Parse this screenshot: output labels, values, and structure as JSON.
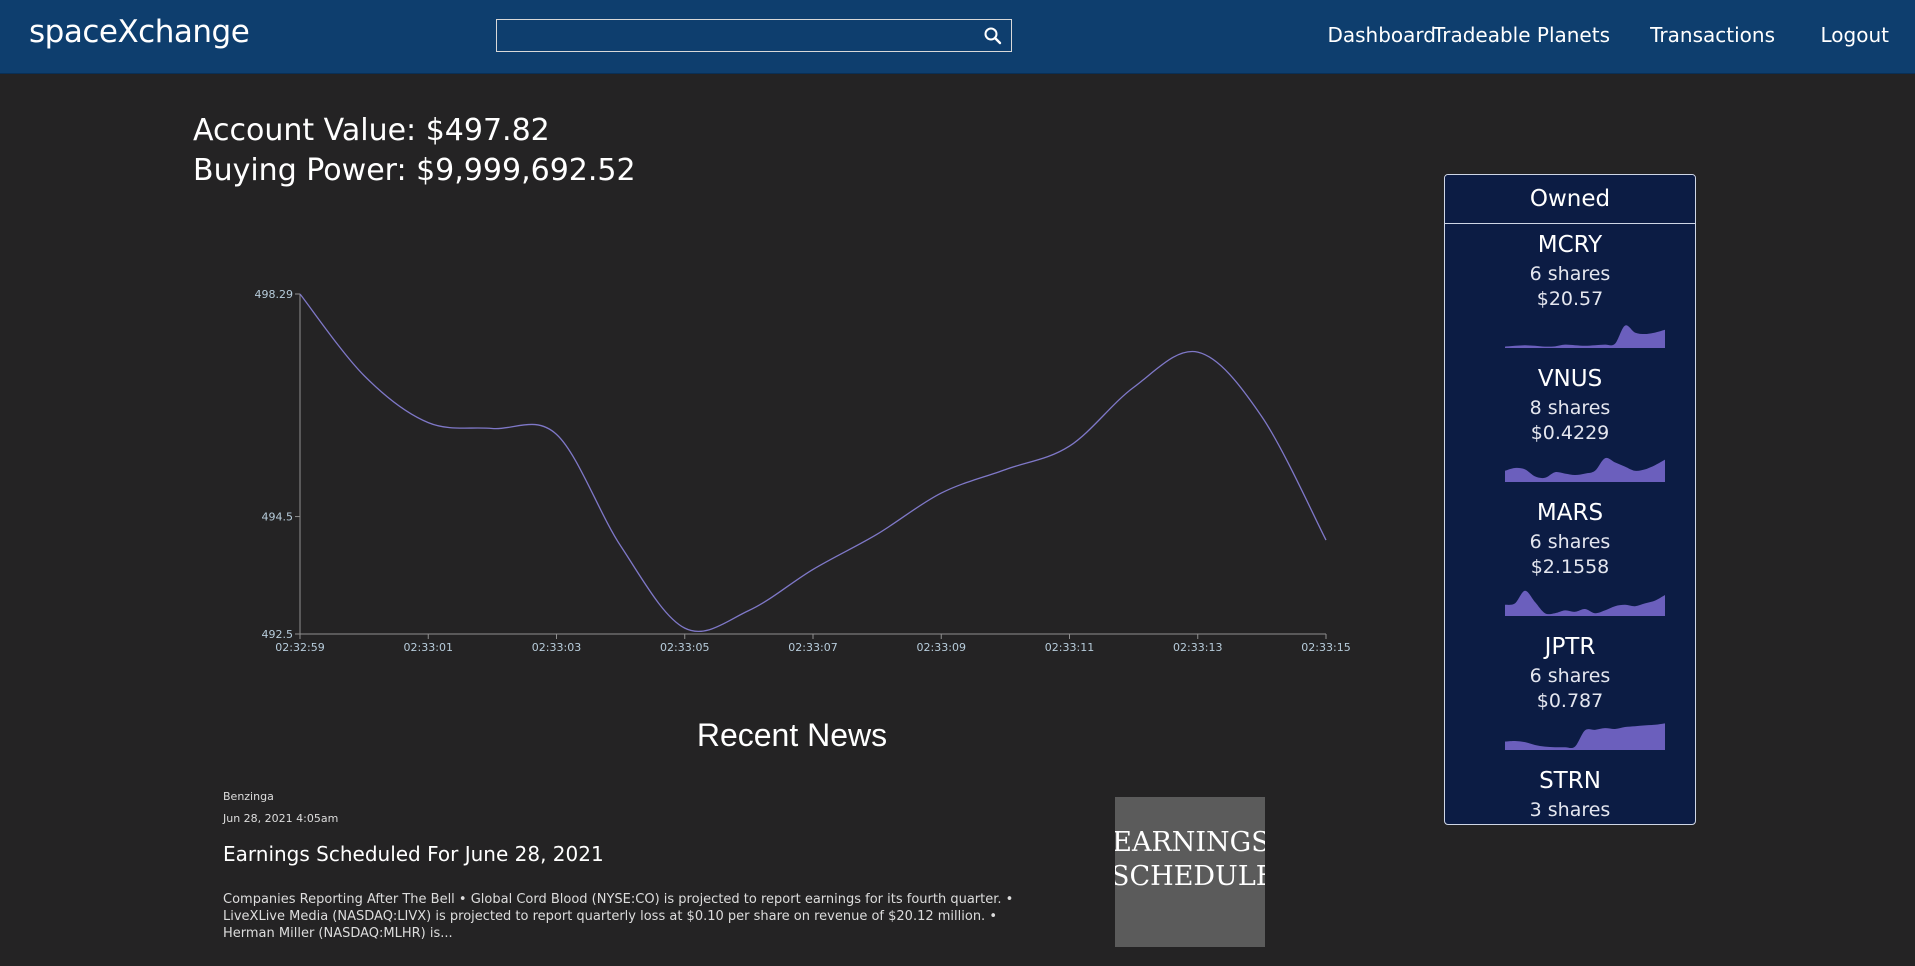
{
  "header": {
    "brand": "spaceXchange",
    "search": {
      "value": "",
      "placeholder": ""
    },
    "nav": [
      "Dashboard",
      "Tradeable Planets",
      "Transactions",
      "Logout"
    ]
  },
  "account": {
    "value_text": "Account Value: $497.82",
    "buying_power_text": "Buying Power: $9,999,692.52"
  },
  "chart_data": {
    "type": "line",
    "x": [
      "02:32:59",
      "02:33:00",
      "02:33:01",
      "02:33:02",
      "02:33:03",
      "02:33:04",
      "02:33:05",
      "02:33:06",
      "02:33:07",
      "02:33:08",
      "02:33:09",
      "02:33:10",
      "02:33:11",
      "02:33:12",
      "02:33:13",
      "02:33:14",
      "02:33:15"
    ],
    "values": [
      498.29,
      496.9,
      496.1,
      496.0,
      495.9,
      494.0,
      492.6,
      492.9,
      493.6,
      494.2,
      494.9,
      495.3,
      495.7,
      496.7,
      497.3,
      496.2,
      494.1
    ],
    "y_ticks": [
      498.29,
      494.5,
      492.5
    ],
    "x_ticks": [
      "02:32:59",
      "02:33:01",
      "02:33:03",
      "02:33:05",
      "02:33:07",
      "02:33:09",
      "02:33:11",
      "02:33:13",
      "02:33:15"
    ],
    "ylim": [
      492.5,
      498.29
    ],
    "grid": false,
    "line_color": "#7f78c8",
    "axis_color": "#8f8f8f",
    "label_color": "#b7ccdb"
  },
  "news": {
    "heading": "Recent News",
    "items": [
      {
        "source": "Benzinga",
        "date": "Jun 28, 2021 4:05am",
        "title": "Earnings Scheduled For June 28, 2021",
        "summary": "Companies Reporting After The Bell • Global Cord Blood (NYSE:CO) is projected to report earnings for its fourth quarter. • LiveXLive Media (NASDAQ:LIVX) is projected to report quarterly loss at $0.10 per share on revenue of $20.12 million. • Herman Miller (NASDAQ:MLHR) is...",
        "thumb_lines": [
          "EARNINGS",
          "SCHEDULED"
        ]
      }
    ]
  },
  "owned": {
    "title": "Owned",
    "fill_color": "#6b5fbd",
    "holdings": [
      {
        "symbol": "MCRY",
        "shares": "6 shares",
        "price": "$20.57",
        "spark": [
          0.05,
          0.08,
          0.1,
          0.08,
          0.05,
          0.06,
          0.12,
          0.1,
          0.08,
          0.1,
          0.12,
          0.15,
          0.8,
          0.55,
          0.5,
          0.55,
          0.65
        ]
      },
      {
        "symbol": "VNUS",
        "shares": "8 shares",
        "price": "$0.4229",
        "spark": [
          0.4,
          0.5,
          0.45,
          0.2,
          0.15,
          0.35,
          0.3,
          0.25,
          0.3,
          0.4,
          0.85,
          0.7,
          0.55,
          0.4,
          0.45,
          0.6,
          0.8
        ]
      },
      {
        "symbol": "MARS",
        "shares": "6 shares",
        "price": "$2.1558",
        "spark": [
          0.4,
          0.45,
          0.9,
          0.5,
          0.1,
          0.1,
          0.2,
          0.15,
          0.25,
          0.1,
          0.2,
          0.35,
          0.4,
          0.35,
          0.45,
          0.55,
          0.75
        ]
      },
      {
        "symbol": "JPTR",
        "shares": "6 shares",
        "price": "$0.787",
        "spark": [
          0.3,
          0.32,
          0.28,
          0.18,
          0.12,
          0.1,
          0.1,
          0.12,
          0.7,
          0.72,
          0.78,
          0.75,
          0.82,
          0.85,
          0.88,
          0.9,
          0.95
        ]
      },
      {
        "symbol": "STRN",
        "shares": "3 shares",
        "price": "",
        "spark": []
      }
    ]
  }
}
